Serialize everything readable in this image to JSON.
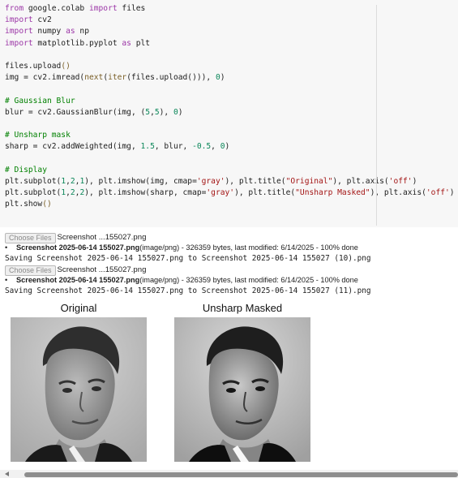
{
  "code_lines": [
    {
      "segments": [
        {
          "t": "from",
          "c": "kw"
        },
        {
          "t": " google.colab "
        },
        {
          "t": "import",
          "c": "kw"
        },
        {
          "t": " files"
        }
      ]
    },
    {
      "segments": [
        {
          "t": "import",
          "c": "kw"
        },
        {
          "t": " cv2"
        }
      ]
    },
    {
      "segments": [
        {
          "t": "import",
          "c": "kw"
        },
        {
          "t": " numpy "
        },
        {
          "t": "as",
          "c": "kw"
        },
        {
          "t": " np"
        }
      ]
    },
    {
      "segments": [
        {
          "t": "import",
          "c": "kw"
        },
        {
          "t": " matplotlib.pyplot "
        },
        {
          "t": "as",
          "c": "kw"
        },
        {
          "t": " plt"
        }
      ]
    },
    {
      "segments": []
    },
    {
      "segments": [
        {
          "t": "files.upload"
        },
        {
          "t": "()",
          "c": "fn"
        }
      ]
    },
    {
      "segments": [
        {
          "t": "img = cv2.imread("
        },
        {
          "t": "next",
          "c": "fn"
        },
        {
          "t": "("
        },
        {
          "t": "iter",
          "c": "fn"
        },
        {
          "t": "(files.upload())), "
        },
        {
          "t": "0",
          "c": "num"
        },
        {
          "t": ")"
        }
      ]
    },
    {
      "segments": []
    },
    {
      "segments": [
        {
          "t": "# Gaussian Blur",
          "c": "cm"
        }
      ]
    },
    {
      "segments": [
        {
          "t": "blur = cv2.GaussianBlur(img, ("
        },
        {
          "t": "5",
          "c": "num"
        },
        {
          "t": ","
        },
        {
          "t": "5",
          "c": "num"
        },
        {
          "t": "), "
        },
        {
          "t": "0",
          "c": "num"
        },
        {
          "t": ")"
        }
      ]
    },
    {
      "segments": []
    },
    {
      "segments": [
        {
          "t": "# Unsharp mask",
          "c": "cm"
        }
      ]
    },
    {
      "segments": [
        {
          "t": "sharp = cv2.addWeighted(img, "
        },
        {
          "t": "1.5",
          "c": "num"
        },
        {
          "t": ", blur, "
        },
        {
          "t": "-0.5",
          "c": "num"
        },
        {
          "t": ", "
        },
        {
          "t": "0",
          "c": "num"
        },
        {
          "t": ")"
        }
      ]
    },
    {
      "segments": []
    },
    {
      "segments": [
        {
          "t": "# Display",
          "c": "cm"
        }
      ]
    },
    {
      "segments": [
        {
          "t": "plt.subplot("
        },
        {
          "t": "1",
          "c": "num"
        },
        {
          "t": ","
        },
        {
          "t": "2",
          "c": "num"
        },
        {
          "t": ","
        },
        {
          "t": "1",
          "c": "num"
        },
        {
          "t": "), plt.imshow(img, cmap="
        },
        {
          "t": "'gray'",
          "c": "str"
        },
        {
          "t": "), plt.title("
        },
        {
          "t": "\"Original\"",
          "c": "str"
        },
        {
          "t": "), plt.axis("
        },
        {
          "t": "'off'",
          "c": "str"
        },
        {
          "t": ")"
        }
      ]
    },
    {
      "segments": [
        {
          "t": "plt.subplot("
        },
        {
          "t": "1",
          "c": "num"
        },
        {
          "t": ","
        },
        {
          "t": "2",
          "c": "num"
        },
        {
          "t": ","
        },
        {
          "t": "2",
          "c": "num"
        },
        {
          "t": "), plt.imshow(sharp, cmap="
        },
        {
          "t": "'gray'",
          "c": "str"
        },
        {
          "t": "), plt.title("
        },
        {
          "t": "\"Unsharp Masked\"",
          "c": "str"
        },
        {
          "t": "), plt.axis("
        },
        {
          "t": "'off'",
          "c": "str"
        },
        {
          "t": ")"
        }
      ]
    },
    {
      "segments": [
        {
          "t": "plt.show"
        },
        {
          "t": "()",
          "c": "fn"
        }
      ]
    }
  ],
  "uploads": [
    {
      "button_label": "Choose Files",
      "chosen_file": "Screenshot ...155027.png",
      "file_name": "Screenshot 2025-06-14 155027.png",
      "file_details": "(image/png) - 326359 bytes, last modified: 6/14/2025 - 100% done",
      "saving_text": "Saving Screenshot 2025-06-14 155027.png to Screenshot 2025-06-14 155027 (10).png"
    },
    {
      "button_label": "Choose Files",
      "chosen_file": "Screenshot ...155027.png",
      "file_name": "Screenshot 2025-06-14 155027.png",
      "file_details": "(image/png) - 326359 bytes, last modified: 6/14/2025 - 100% done",
      "saving_text": "Saving Screenshot 2025-06-14 155027.png to Screenshot 2025-06-14 155027 (11).png"
    }
  ],
  "plots": [
    {
      "title": "Original",
      "variant": "original"
    },
    {
      "title": "Unsharp Masked",
      "variant": "sharp"
    }
  ],
  "colors": {
    "code_bg": "#f7f7f7",
    "keyword": "#9b35a6",
    "number": "#098658",
    "string": "#a31515",
    "comment": "#008000"
  }
}
